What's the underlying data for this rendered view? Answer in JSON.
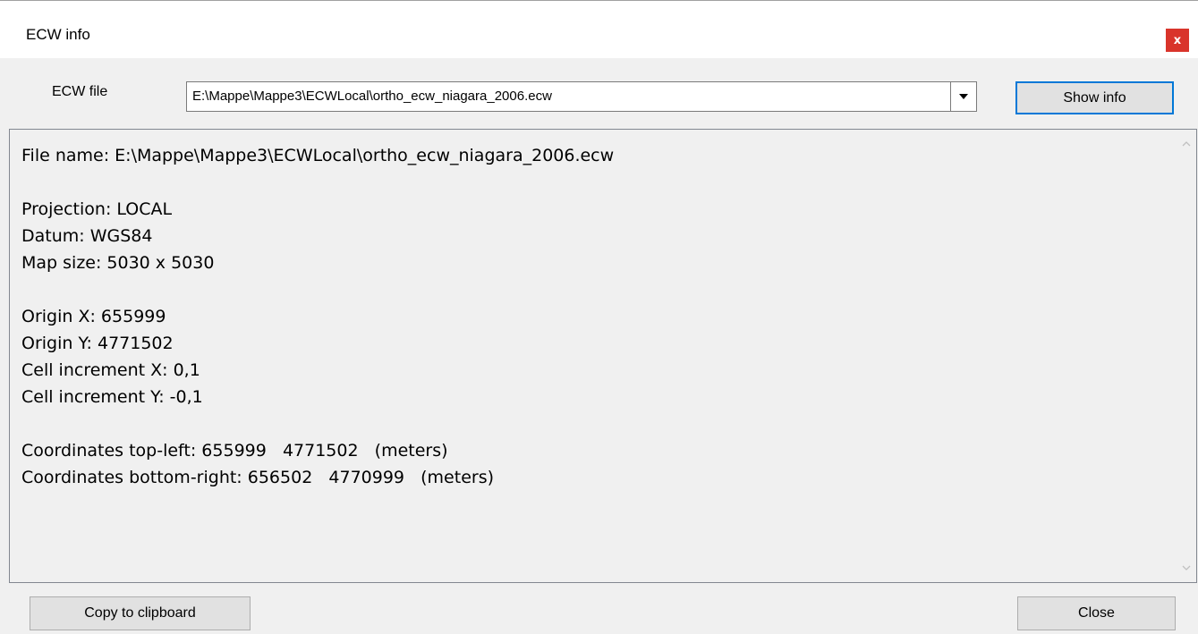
{
  "window": {
    "title": "ECW info",
    "close_glyph": "x"
  },
  "form": {
    "file_label": "ECW file",
    "file_value": "E:\\Mappe\\Mappe3\\ECWLocal\\ortho_ecw_niagara_2006.ecw",
    "show_info_label": "Show info"
  },
  "info": {
    "lines": [
      "File name: E:\\Mappe\\Mappe3\\ECWLocal\\ortho_ecw_niagara_2006.ecw",
      "",
      "Projection: LOCAL",
      "Datum: WGS84",
      "Map size: 5030 x 5030",
      "",
      "Origin X: 655999",
      "Origin Y: 4771502",
      "Cell increment X: 0,1",
      "Cell increment Y: -0,1",
      "",
      "Coordinates top-left: 655999   4771502   (meters)",
      "Coordinates bottom-right: 656502   4770999   (meters)"
    ]
  },
  "footer": {
    "copy_label": "Copy to clipboard",
    "close_label": "Close"
  },
  "icons": {
    "combo_arrow": "chevron-down-icon",
    "scroll_up": "scroll-up-icon",
    "scroll_down": "scroll-down-icon"
  },
  "colors": {
    "close_button": "#d9342b",
    "default_button_border": "#0078d7",
    "dialog_background": "#f0f0f0"
  }
}
